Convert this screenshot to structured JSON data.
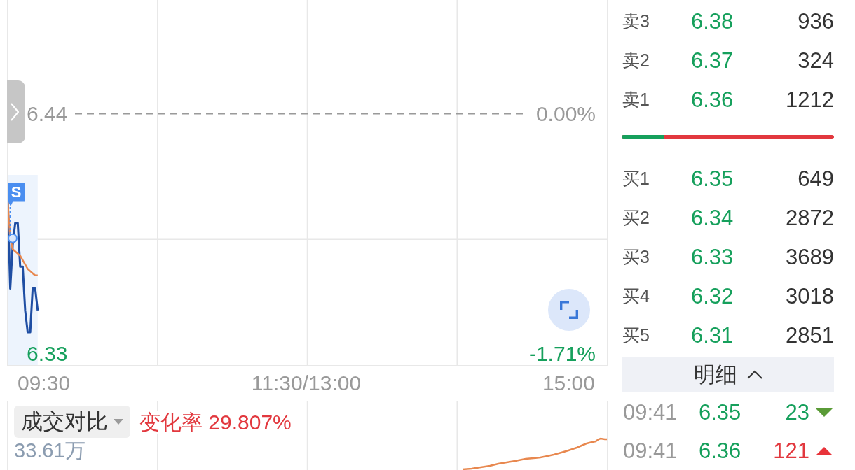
{
  "chart": {
    "chart_data": {
      "type": "line",
      "categories": [
        null,
        null,
        null,
        null,
        null,
        null,
        null,
        null,
        null,
        null,
        null,
        null,
        null,
        null,
        null,
        null,
        null,
        null,
        null,
        null,
        null,
        null,
        null,
        null,
        null,
        null,
        null,
        null,
        null,
        null,
        null,
        null,
        null,
        null,
        null,
        null,
        null,
        null,
        null,
        null,
        null,
        null,
        null,
        null,
        null,
        null,
        null,
        null,
        null,
        null,
        null,
        null,
        null,
        null,
        null,
        null,
        null,
        null,
        null,
        null,
        null,
        null,
        null,
        null,
        null,
        null,
        null,
        null,
        null,
        null,
        null,
        null,
        null,
        null,
        null,
        null,
        null,
        null,
        null,
        null,
        null,
        null,
        null,
        null,
        null,
        null,
        null,
        null,
        null,
        null,
        null,
        null,
        null,
        null,
        null,
        null,
        null,
        null,
        null,
        null,
        null,
        null,
        null,
        null,
        null,
        null,
        null,
        null,
        null,
        null,
        null,
        null,
        null,
        null,
        null,
        null,
        null,
        null,
        null,
        null,
        null,
        null,
        null,
        null,
        null,
        null,
        null,
        null,
        null,
        null,
        null,
        null,
        null,
        null,
        null,
        null,
        null,
        null,
        null,
        null,
        null,
        null,
        null,
        null,
        null,
        null,
        null,
        null,
        null,
        null,
        null,
        null,
        null,
        null,
        null,
        null,
        null,
        null,
        null,
        null,
        null,
        null,
        null,
        null,
        null,
        null,
        null,
        null,
        null,
        null,
        null,
        null,
        null,
        null,
        null,
        null,
        null,
        null,
        null,
        null,
        null,
        null,
        null,
        null,
        null,
        null,
        null,
        null,
        null,
        null,
        null,
        null,
        null,
        null,
        null,
        null,
        null,
        null,
        null,
        null,
        null,
        null,
        null,
        null,
        null,
        null,
        null,
        null,
        null,
        null,
        null,
        null,
        null,
        null,
        null,
        null,
        null,
        null,
        null,
        null,
        null,
        null,
        null,
        null,
        null,
        null,
        null,
        null,
        null,
        null,
        null,
        null,
        null,
        null,
        null,
        null,
        null,
        null,
        null,
        null,
        null
      ],
      "series": [
        {
          "color": "#1f4ea3",
          "values": [
            6.4,
            6.36,
            6.38,
            6.39,
            6.39,
            6.37,
            6.37,
            6.35,
            6.34,
            6.34,
            6.36,
            6.36,
            6.35,
            null,
            null,
            null,
            null,
            null,
            null,
            null,
            null,
            null,
            null,
            null,
            null,
            null,
            null,
            null,
            null,
            null,
            null,
            null,
            null,
            null,
            null,
            null,
            null,
            null,
            null,
            null,
            null,
            null,
            null,
            null,
            null,
            null,
            null,
            null,
            null,
            null,
            null,
            null,
            null,
            null,
            null,
            null,
            null,
            null,
            null,
            null,
            null,
            null,
            null,
            null,
            null,
            null,
            null,
            null,
            null,
            null,
            null,
            null,
            null,
            null,
            null,
            null,
            null,
            null,
            null,
            null,
            null,
            null,
            null,
            null,
            null,
            null,
            null,
            null,
            null,
            null,
            null,
            null,
            null,
            null,
            null,
            null,
            null,
            null,
            null,
            null,
            null,
            null,
            null,
            null,
            null,
            null,
            null,
            null,
            null,
            null,
            null,
            null,
            null,
            null,
            null,
            null,
            null,
            null,
            null,
            null,
            null,
            null,
            null,
            null,
            null,
            null,
            null,
            null,
            null,
            null,
            null,
            null,
            null,
            null,
            null,
            null,
            null,
            null,
            null,
            null,
            null,
            null,
            null,
            null,
            null,
            null,
            null,
            null,
            null,
            null,
            null,
            null,
            null,
            null,
            null,
            null,
            null,
            null,
            null,
            null,
            null,
            null,
            null,
            null,
            null,
            null,
            null,
            null,
            null,
            null,
            null,
            null,
            null,
            null,
            null,
            null,
            null,
            null,
            null,
            null,
            null,
            null,
            null,
            null,
            null,
            null,
            null,
            null,
            null,
            null,
            null,
            null,
            null,
            null,
            null,
            null,
            null,
            null,
            null,
            null,
            null,
            null,
            null,
            null,
            null,
            null,
            null,
            null,
            null,
            null,
            null,
            null,
            null,
            null,
            null,
            null,
            null,
            null,
            null,
            null,
            null,
            null,
            null,
            null,
            null,
            null,
            null,
            null,
            null,
            null,
            null,
            null,
            null,
            null,
            null,
            null,
            null,
            null,
            null,
            null,
            null
          ]
        },
        {
          "color": "#e8884f",
          "values": [
            6.4,
            6.383,
            6.378,
            6.377,
            6.376,
            6.375,
            6.373,
            6.371,
            6.369,
            6.368,
            6.367,
            6.366,
            6.366,
            null,
            null,
            null,
            null,
            null,
            null,
            null,
            null,
            null,
            null,
            null,
            null,
            null,
            null,
            null,
            null,
            null,
            null,
            null,
            null,
            null,
            null,
            null,
            null,
            null,
            null,
            null,
            null,
            null,
            null,
            null,
            null,
            null,
            null,
            null,
            null,
            null,
            null,
            null,
            null,
            null,
            null,
            null,
            null,
            null,
            null,
            null,
            null,
            null,
            null,
            null,
            null,
            null,
            null,
            null,
            null,
            null,
            null,
            null,
            null,
            null,
            null,
            null,
            null,
            null,
            null,
            null,
            null,
            null,
            null,
            null,
            null,
            null,
            null,
            null,
            null,
            null,
            null,
            null,
            null,
            null,
            null,
            null,
            null,
            null,
            null,
            null,
            null,
            null,
            null,
            null,
            null,
            null,
            null,
            null,
            null,
            null,
            null,
            null,
            null,
            null,
            null,
            null,
            null,
            null,
            null,
            null,
            null,
            null,
            null,
            null,
            null,
            null,
            null,
            null,
            null,
            null,
            null,
            null,
            null,
            null,
            null,
            null,
            null,
            null,
            null,
            null,
            null,
            null,
            null,
            null,
            null,
            null,
            null,
            null,
            null,
            null,
            null,
            null,
            null,
            null,
            null,
            null,
            null,
            null,
            null,
            null,
            null,
            null,
            null,
            null,
            null,
            null,
            null,
            null,
            null,
            null,
            null,
            null,
            null,
            null,
            null,
            null,
            null,
            null,
            null,
            null,
            null,
            null,
            null,
            null,
            null,
            null,
            null,
            null,
            null,
            null,
            null,
            null,
            null,
            null,
            null,
            null,
            null,
            null,
            null,
            null,
            null,
            null,
            null,
            null,
            null,
            null,
            null,
            null,
            null,
            null,
            null,
            null,
            null,
            null,
            null,
            null,
            null,
            null,
            null,
            null,
            null,
            null,
            null,
            null,
            null,
            null,
            null,
            null,
            null,
            null,
            null,
            null,
            null,
            null,
            null,
            null,
            null,
            null,
            null,
            null,
            null
          ]
        }
      ],
      "ylim": [
        6.325,
        6.492
      ],
      "yticks": [
        {
          "value": 6.44,
          "label": "6.44"
        },
        {
          "value": 6.33,
          "label": "6.33"
        }
      ],
      "ref_lines": [
        {
          "axis": "y",
          "value": 6.44
        }
      ]
    },
    "signal_marker": "S",
    "change_labels": [
      "0.00%",
      "-1.71%"
    ],
    "time_axis": [
      "09:30",
      "11:30/13:00",
      "15:00"
    ]
  },
  "volume_panel": {
    "compare_dropdown": "成交对比",
    "change_rate": "变化率 29.807%",
    "max_volume": "33.61万"
  },
  "order_book": {
    "asks": [
      {
        "label": "卖3",
        "price": "6.38",
        "volume": "936"
      },
      {
        "label": "卖2",
        "price": "6.37",
        "volume": "324"
      },
      {
        "label": "卖1",
        "price": "6.36",
        "volume": "1212"
      }
    ],
    "ratio_bar": {
      "level": 0.2
    },
    "bids": [
      {
        "label": "买1",
        "price": "6.35",
        "volume": "649"
      },
      {
        "label": "买2",
        "price": "6.34",
        "volume": "2872"
      },
      {
        "label": "买3",
        "price": "6.33",
        "volume": "3689"
      },
      {
        "label": "买4",
        "price": "6.32",
        "volume": "3018"
      },
      {
        "label": "买5",
        "price": "6.31",
        "volume": "2851"
      }
    ]
  },
  "details": {
    "title": "明细",
    "expanded": true,
    "trades": [
      {
        "time": "09:41",
        "price": "6.35",
        "volume": "23",
        "kind": "down"
      },
      {
        "time": "09:41",
        "price": "6.36",
        "volume": "121",
        "kind": "up"
      }
    ]
  }
}
